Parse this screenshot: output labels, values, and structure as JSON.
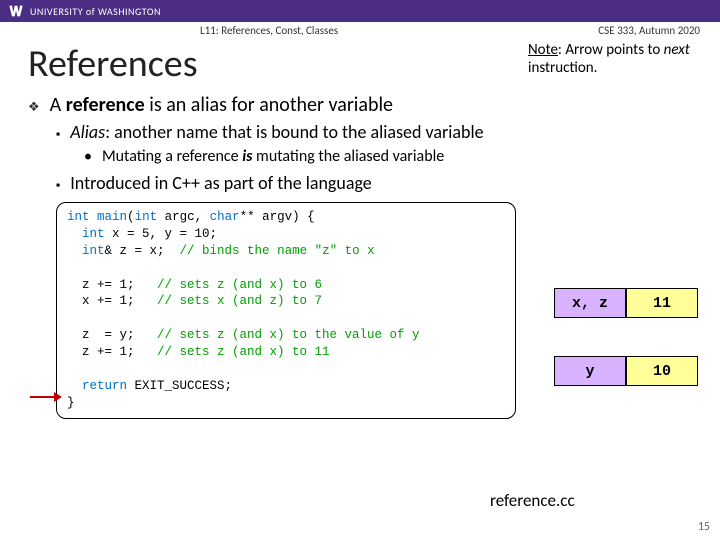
{
  "header": {
    "university": "UNIVERSITY of WASHINGTON",
    "lecture": "L11: References, Const, Classes",
    "course": "CSE 333, Autumn 2020"
  },
  "title": "References",
  "note_prefix": "Note",
  "note_mid1": ": Arrow points to ",
  "note_em": "next",
  "note_mid2": " instruction.",
  "bullets": {
    "b1_a": "A ",
    "b1_b": "reference",
    "b1_c": " is an alias for another variable",
    "b2_a": "Alias",
    "b2_b": ": another name that is bound to the aliased variable",
    "b3_a": "Mutating a reference ",
    "b3_b": "is",
    "b3_c": " mutating the aliased variable",
    "b4": "Introduced in C++ as part of the language"
  },
  "code": {
    "l1a": "int",
    "l1b": " ",
    "l1c": "main",
    "l1d": "(",
    "l1e": "int",
    "l1f": " argc, ",
    "l1g": "char",
    "l1h": "** argv) {",
    "l2a": "  ",
    "l2b": "int",
    "l2c": " x = 5, y = 10;",
    "l3a": "  ",
    "l3b": "int",
    "l3c": "& z = x;  ",
    "l3d": "// binds the name \"z\" to x",
    "l4": " ",
    "l5a": "  z += 1;   ",
    "l5b": "// sets z (and x) to 6",
    "l6a": "  x += 1;   ",
    "l6b": "// sets x (and z) to 7",
    "l7": " ",
    "l8a": "  z  = y;   ",
    "l8b": "// sets z (and x) to the value of y",
    "l9a": "  z += 1;   ",
    "l9b": "// sets z (and x) to 11",
    "l10": " ",
    "l11a": "  ",
    "l11b": "return",
    "l11c": " EXIT_SUCCESS;",
    "l12": "}"
  },
  "table1": {
    "label": "x, z",
    "value": "11"
  },
  "table2": {
    "label": "y",
    "value": "10"
  },
  "filename": "reference.cc",
  "pagenum": "15"
}
